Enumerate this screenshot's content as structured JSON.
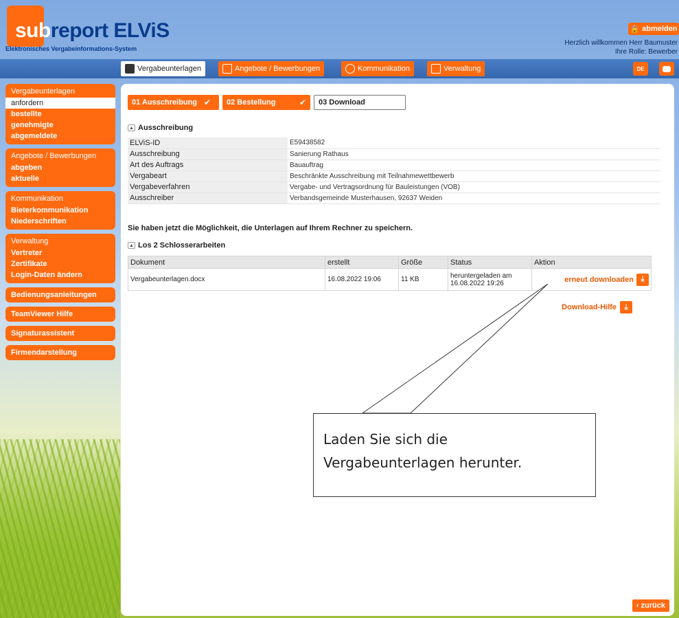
{
  "header": {
    "logo_sub": "sub",
    "logo_main": "report ELViS",
    "logo_tagline": "Elektronisches Vergabeinformations-System",
    "logout_label": "abmelden",
    "welcome": "Herzlich willkommen Herr Baumuster",
    "role": "Ihre Rolle: Bewerber"
  },
  "nav": {
    "tabs": [
      "Vergabeunterlagen",
      "Angebote / Bewerbungen",
      "Kommunikation",
      "Verwaltung"
    ],
    "lang": "DE"
  },
  "sidebar": {
    "group1": {
      "title": "Vergabeunterlagen",
      "items": [
        "anfordern",
        "bestellte",
        "genehmigte",
        "abgemeldete"
      ]
    },
    "group2": {
      "title": "Angebote / Bewerbungen",
      "items": [
        "abgeben",
        "aktuelle"
      ]
    },
    "group3": {
      "title": "Kommunikation",
      "items": [
        "Bieterkommunikation",
        "Niederschriften"
      ]
    },
    "group4": {
      "title": "Verwaltung",
      "items": [
        "Vertreter",
        "Zertifikate",
        "Login-Daten ändern"
      ]
    },
    "singles": [
      "Bedienungsanleitungen",
      "TeamViewer Hilfe",
      "Signaturassistent",
      "Firmendarstellung"
    ]
  },
  "steps": [
    "01 Ausschreibung",
    "02 Bestellung",
    "03 Download"
  ],
  "ausschreibung": {
    "title": "Ausschreibung",
    "rows": [
      {
        "k": "ELViS-ID",
        "v": "E59438582"
      },
      {
        "k": "Ausschreibung",
        "v": "Sanierung Rathaus"
      },
      {
        "k": "Art des Auftrags",
        "v": "Bauauftrag"
      },
      {
        "k": "Vergabeart",
        "v": "Beschränkte Ausschreibung mit Teilnahmewettbewerb"
      },
      {
        "k": "Vergabeverfahren",
        "v": "Vergabe- und Vertragsordnung für Bauleistungen (VOB)"
      },
      {
        "k": "Ausschreiber",
        "v": "Verbandsgemeinde Musterhausen, 92637 Weiden"
      }
    ]
  },
  "save_note": "Sie haben jetzt die Möglichkeit, die Unterlagen auf Ihrem Rechner zu speichern.",
  "los": {
    "title": "Los 2 Schlosserarbeiten",
    "headers": [
      "Dokument",
      "erstellt",
      "Größe",
      "Status",
      "Aktion"
    ],
    "row": {
      "doc": "Vergabeunterlagen.docx",
      "created": "16.08.2022 19:06",
      "size": "11 KB",
      "status1": "heruntergeladen am",
      "status2": "16.08.2022 19:26",
      "action": "erneut downloaden"
    }
  },
  "download_help": "Download-Hilfe",
  "back_label": "zurück",
  "callout": {
    "line1": "Laden Sie sich die",
    "line2": "Vergabeunterlagen herunter."
  }
}
